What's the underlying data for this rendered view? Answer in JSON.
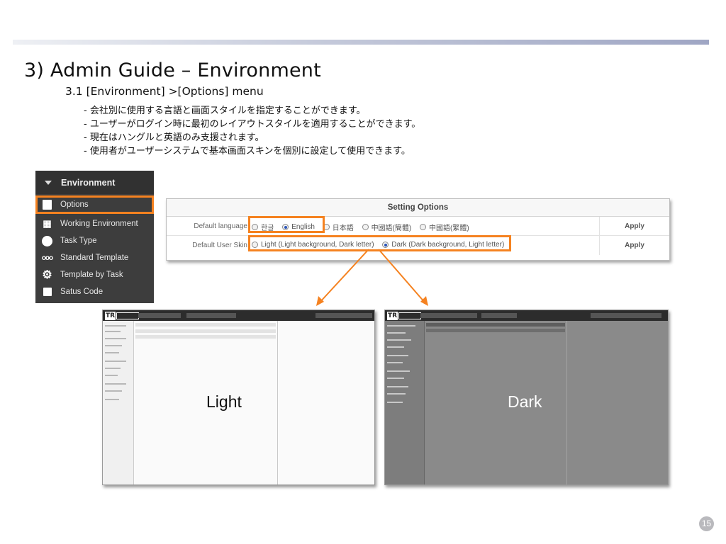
{
  "slide": {
    "title": "3) Admin Guide – Environment",
    "section": "3.1 [Environment] >[Options] menu",
    "bullets": [
      "- 会社別に使用する言語と画面スタイルを指定することができます。",
      "- ユーザーがログイン時に最初のレイアウトスタイルを適用することができます。",
      "- 現在はハングルと英語のみ支援されます。",
      "- 使用者がユーザーシステムで基本画面スキンを個別に設定して使用できます。"
    ],
    "page_number": "15"
  },
  "sidebar": {
    "header": "Environment",
    "items": [
      {
        "label": "Options",
        "icon": "options-icon",
        "selected": true
      },
      {
        "label": "Working Environment",
        "icon": "building-icon",
        "selected": false
      },
      {
        "label": "Task Type",
        "icon": "task-type-icon",
        "selected": false
      },
      {
        "label": "Standard Template",
        "icon": "link-chain-icon",
        "selected": false
      },
      {
        "label": "Template by Task",
        "icon": "gear-icon",
        "selected": false
      },
      {
        "label": "Satus Code",
        "icon": "status-code-icon",
        "selected": false
      }
    ]
  },
  "options_panel": {
    "title": "Setting Options",
    "language": {
      "label": "Default language",
      "choices": [
        "한글",
        "English",
        "日本語",
        "中國語(簡體)",
        "中國語(繁體)"
      ],
      "selected": "English",
      "apply": "Apply"
    },
    "skin": {
      "label": "Default User Skin",
      "choices": [
        "Light (Light background, Dark letter)",
        "Dark (Dark background, Light letter)"
      ],
      "selected": "Dark (Dark background, Light letter)",
      "apply": "Apply"
    }
  },
  "previews": {
    "light_caption": "Light",
    "dark_caption": "Dark"
  },
  "colors": {
    "highlight": "#f58220",
    "menu_bg": "#3d3d3d",
    "radio_on": "#2a55b8"
  }
}
